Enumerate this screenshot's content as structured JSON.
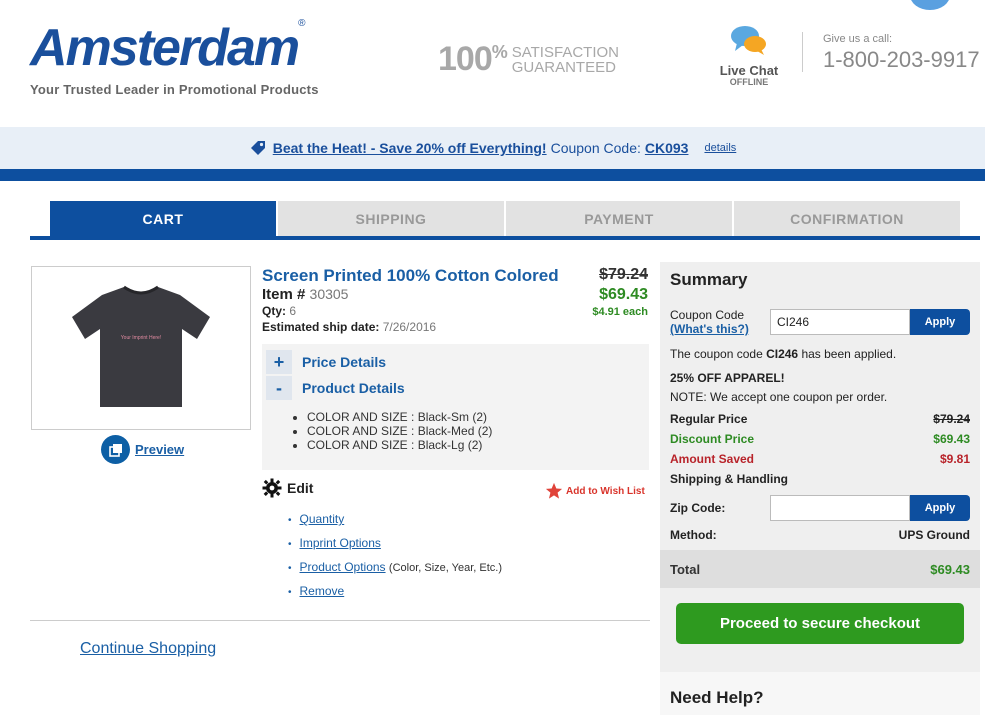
{
  "header": {
    "logo_text": "Amsterdam",
    "logo_reg": "®",
    "tagline": "Your Trusted Leader in Promotional Products",
    "satisfaction_num": "100",
    "satisfaction_pct": "%",
    "satisfaction_line1": "SATISFACTION",
    "satisfaction_line2": "GUARANTEED",
    "livechat_label": "Live Chat",
    "livechat_status": "OFFLINE",
    "call_label": "Give us a call:",
    "call_phone": "1-800-203-9917"
  },
  "promo": {
    "headline": "Beat the Heat! - Save 20% off Everything!",
    "code_label": "Coupon Code:",
    "code": "CK093",
    "details": "details"
  },
  "steps": [
    "CART",
    "SHIPPING",
    "PAYMENT",
    "CONFIRMATION"
  ],
  "product": {
    "title": "Screen Printed 100% Cotton Colored",
    "item_label": "Item #",
    "item_number": "30305",
    "qty_label": "Qty:",
    "qty": "6",
    "ship_label": "Estimated ship date:",
    "ship_date": "7/26/2016",
    "price_old": "$79.24",
    "price_new": "$69.43",
    "price_each": "$4.91 each",
    "shirt_imprint": "Your Imprint Here!",
    "preview": "Preview",
    "price_details": "Price Details",
    "product_details": "Product Details",
    "toggle_plus": "+",
    "toggle_minus": "-",
    "colors": [
      "COLOR AND SIZE : Black-Sm (2)",
      "COLOR AND SIZE : Black-Med (2)",
      "COLOR AND SIZE : Black-Lg (2)"
    ],
    "edit": "Edit",
    "wishlist": "Add to Wish List",
    "edit_links": {
      "quantity": "Quantity",
      "imprint": "Imprint Options",
      "product_options": "Product Options",
      "product_options_note": "(Color, Size, Year, Etc.)",
      "remove": "Remove"
    },
    "continue": "Continue Shopping"
  },
  "summary": {
    "title": "Summary",
    "coupon_label": "Coupon Code",
    "whats_this": "(What's this?)",
    "coupon_value": "CI246",
    "apply": "Apply",
    "applied_pre": "The coupon code ",
    "applied_code": "CI246",
    "applied_post": " has been applied.",
    "offer": "25% OFF APPAREL!",
    "note": "NOTE: We accept one coupon per order.",
    "regular_label": "Regular Price",
    "regular_value": "$79.24",
    "discount_label": "Discount Price",
    "discount_value": "$69.43",
    "saved_label": "Amount Saved",
    "saved_value": "$9.81",
    "shipping_label": "Shipping & Handling",
    "zip_label": "Zip Code:",
    "zip_value": "",
    "method_label": "Method:",
    "method_value": "UPS Ground",
    "total_label": "Total",
    "total_value": "$69.43",
    "checkout": "Proceed to secure checkout",
    "help": "Need Help?"
  },
  "colors": {
    "brand_blue": "#0d4f9f",
    "link_blue": "#1a5fa5",
    "green": "#2e8b23",
    "red": "#b8232a"
  }
}
